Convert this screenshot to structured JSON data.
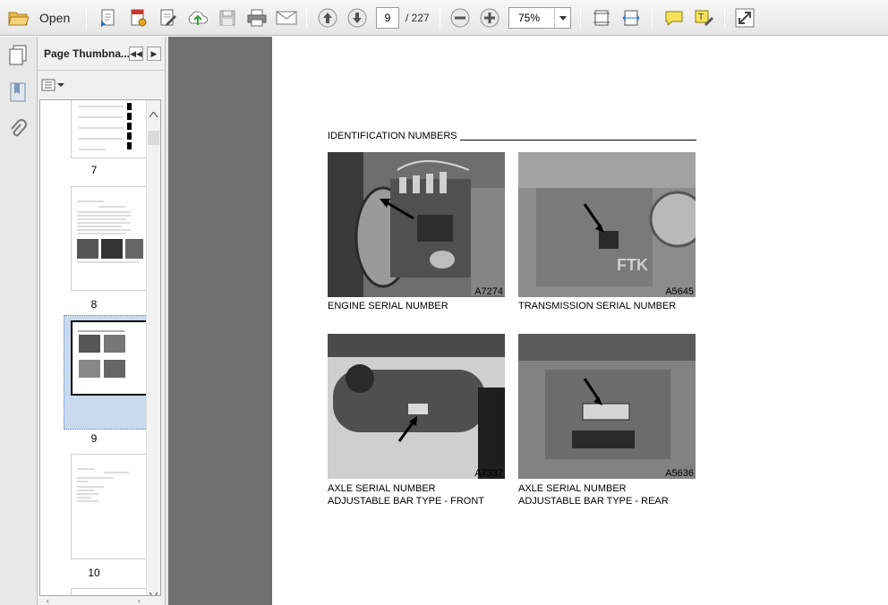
{
  "toolbar": {
    "open_label": "Open",
    "page_current": "9",
    "page_total": "/ 227",
    "zoom": "75%"
  },
  "sidebar": {
    "title": "Page Thumbna...",
    "thumbs": [
      {
        "label": "7"
      },
      {
        "label": "8"
      },
      {
        "label": "9"
      },
      {
        "label": "10"
      }
    ]
  },
  "document": {
    "heading": "IDENTIFICATION NUMBERS",
    "photos": [
      {
        "code": "A7274",
        "caption_1": "ENGINE SERIAL NUMBER",
        "caption_2": ""
      },
      {
        "code": "A5645",
        "caption_1": "TRANSMISSION SERIAL NUMBER",
        "caption_2": ""
      },
      {
        "code": "A7337",
        "caption_1": "AXLE SERIAL NUMBER",
        "caption_2": "ADJUSTABLE BAR TYPE - FRONT"
      },
      {
        "code": "A5636",
        "caption_1": "AXLE SERIAL NUMBER",
        "caption_2": "ADJUSTABLE BAR TYPE - REAR"
      }
    ]
  },
  "colors": {
    "toolbar_bg": "#ececec",
    "doc_bg": "#6f6f6f",
    "selection": "#c9d9ee"
  }
}
